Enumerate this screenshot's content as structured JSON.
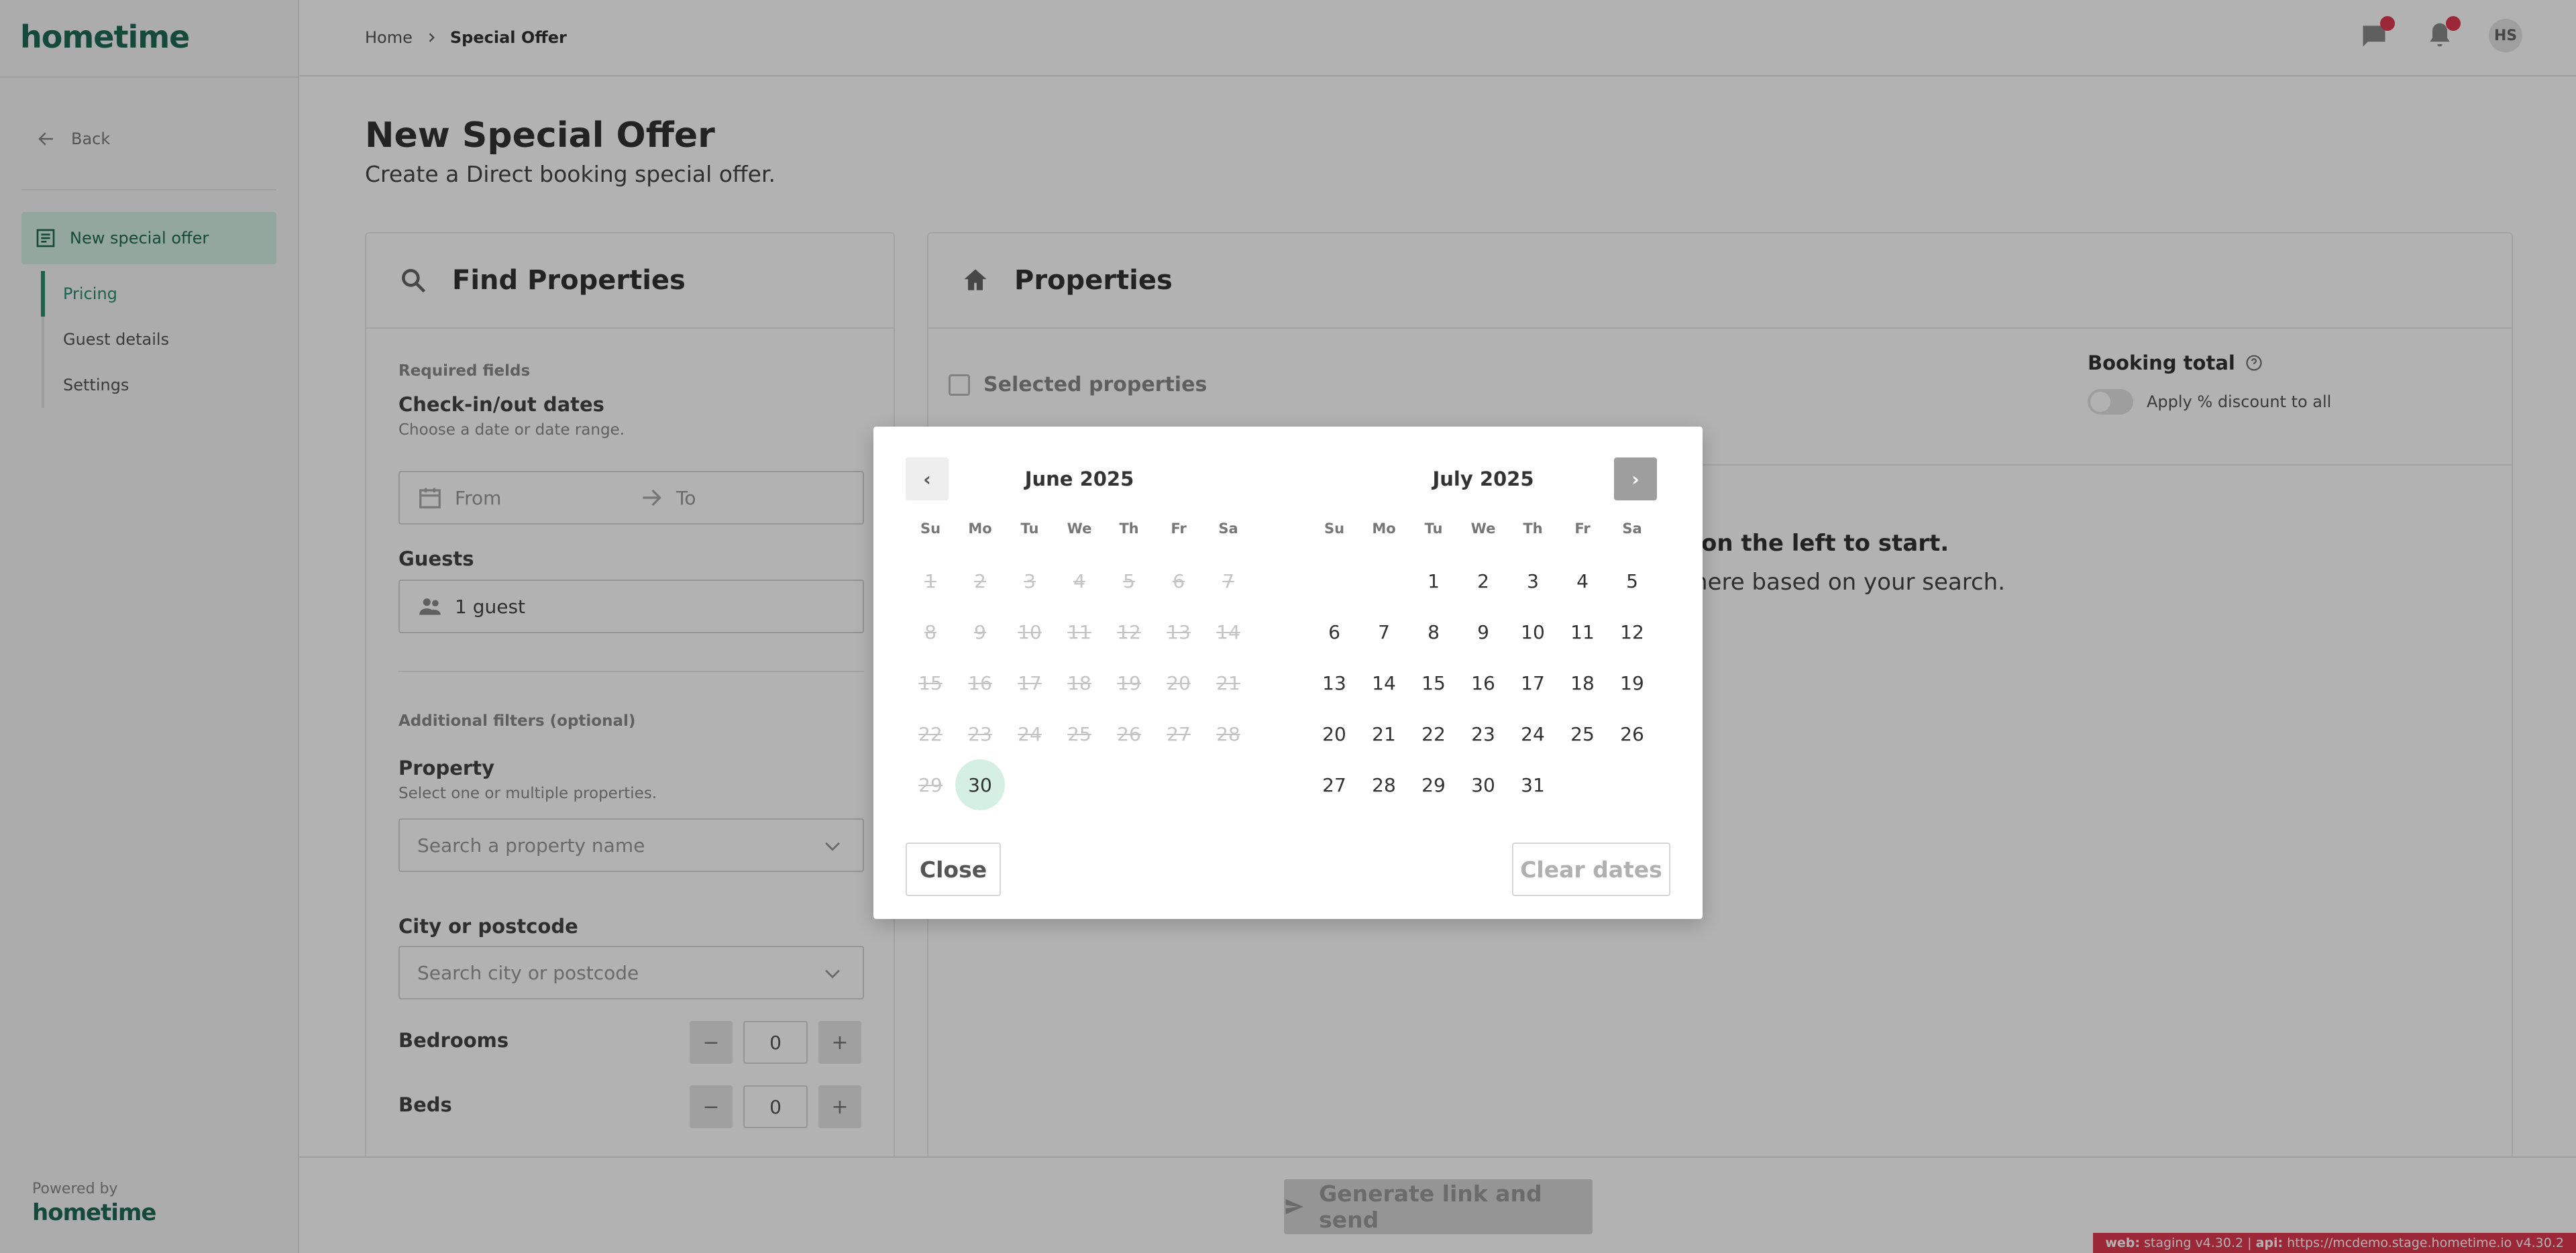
{
  "brand": {
    "logo": "hometime",
    "powered_by": "Powered by"
  },
  "sidebar": {
    "back": "Back",
    "active_item": "New special offer",
    "subitems": [
      {
        "label": "Pricing"
      },
      {
        "label": "Guest details"
      },
      {
        "label": "Settings"
      }
    ]
  },
  "header": {
    "breadcrumb": [
      "Home",
      "Special Offer"
    ],
    "avatar_initials": "HS"
  },
  "page": {
    "title": "New Special Offer",
    "subtitle": "Create a Direct booking special offer."
  },
  "find": {
    "title": "Find Properties",
    "required": "Required fields",
    "dates_label": "Check-in/out dates",
    "dates_help": "Choose a date or date range.",
    "from_placeholder": "From",
    "to_placeholder": "To",
    "guests_label": "Guests",
    "guests_value": "1 guest",
    "additional": "Additional filters (optional)",
    "property_label": "Property",
    "property_help": "Select one or multiple properties.",
    "property_placeholder": "Search a property name",
    "city_label": "City or postcode",
    "city_placeholder": "Search city or postcode",
    "bedrooms_label": "Bedrooms",
    "bedrooms_value": "0",
    "beds_label": "Beds",
    "beds_value": "0",
    "minus": "−",
    "plus": "+"
  },
  "properties": {
    "title": "Properties",
    "selected": "Selected properties",
    "booking_total": "Booking total",
    "apply_discount": "Apply % discount to all",
    "empty_line1": "on the left to start.",
    "empty_line2": "here based on your search."
  },
  "footer": {
    "generate": "Generate link and send",
    "version_web_label": "web:",
    "version_web": "staging v4.30.2 |",
    "version_api_label": "api:",
    "version_api": "https://mcdemo.stage.hometime.io v4.30.2"
  },
  "modal": {
    "prev": "‹",
    "next": "›",
    "close": "Close",
    "clear": "Clear dates",
    "weekdays": [
      "Su",
      "Mo",
      "Tu",
      "We",
      "Th",
      "Fr",
      "Sa"
    ],
    "months": [
      {
        "name": "June 2025",
        "offset": 0,
        "days": 30,
        "disabled_through": 29,
        "today": 30
      },
      {
        "name": "July 2025",
        "offset": 2,
        "days": 31,
        "disabled_through": 0,
        "today": 0
      }
    ]
  },
  "colors": {
    "brand": "#1f6b55",
    "accent": "#2a8d6e",
    "active_bg": "#d5f0e3",
    "notification": "#e0394f"
  },
  "icons": {
    "back": "arrow-left-icon",
    "offer": "document-icon",
    "chat": "chat-icon",
    "bell": "bell-icon",
    "search": "search-icon",
    "home": "home-icon",
    "calendar": "calendar-icon",
    "people": "people-icon",
    "send": "send-icon"
  }
}
